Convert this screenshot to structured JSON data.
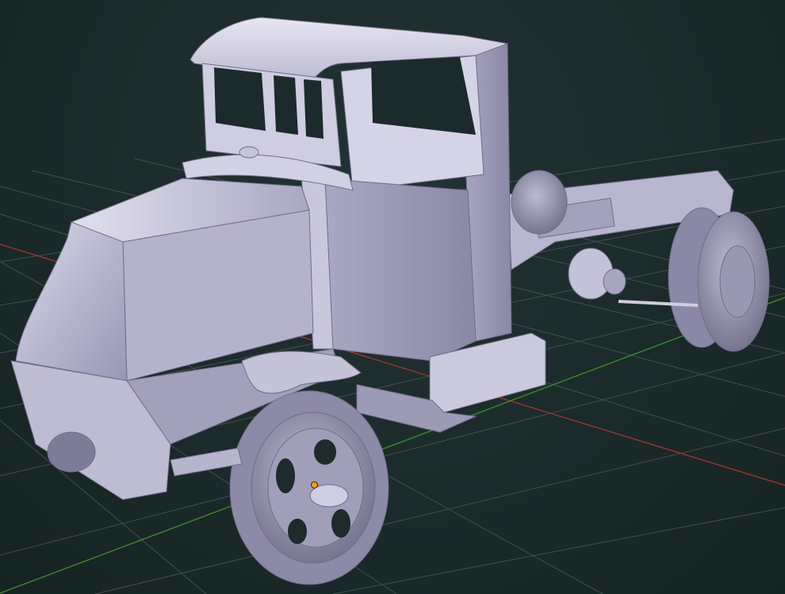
{
  "viewport": {
    "label": "",
    "background": "#1d2b2b",
    "grid_color": "#4a5656",
    "axis_x_color": "#a03434",
    "axis_y_color": "#3c8a2e",
    "origin_color": "#f39b22",
    "object_color": "#b8b6cf"
  },
  "object": {
    "name": "",
    "type": "truck-mesh"
  }
}
